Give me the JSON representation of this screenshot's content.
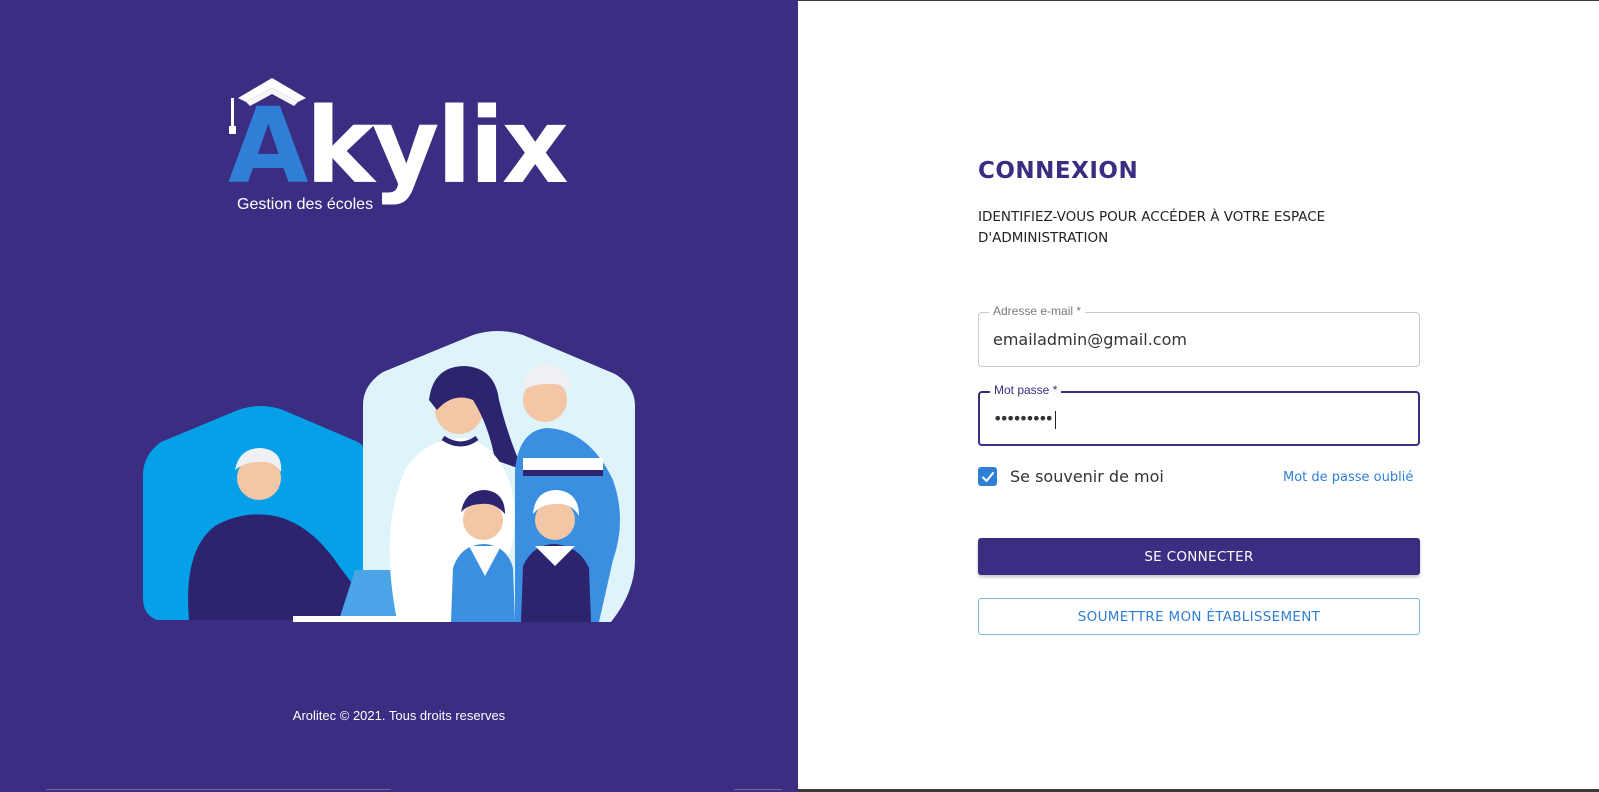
{
  "brand": {
    "name_first_letter": "A",
    "name_rest": "kylix",
    "tagline": "Gestion des écoles",
    "accent_color": "#2f7fd6",
    "panel_color": "#3a2d82"
  },
  "footer": {
    "copyright": "Arolitec © 2021. Tous droits reserves"
  },
  "login": {
    "title": "CONNEXION",
    "subtitle": "IDENTIFIEZ-VOUS POUR ACCÉDER À VOTRE ESPACE D'ADMINISTRATION",
    "email": {
      "label": "Adresse e-mail *",
      "value": "emailadmin@gmail.com"
    },
    "password": {
      "label": "Mot passe *",
      "value": "•••••••••"
    },
    "remember_me": {
      "label": "Se souvenir de moi",
      "checked": true
    },
    "forgot_password": "Mot de passe oublié",
    "submit_label": "SE CONNECTER",
    "secondary_label": "SOUMETTRE MON ÉTABLISSEMENT"
  },
  "icons": {
    "check": "check-icon",
    "graduation_cap": "graduation-cap-icon"
  }
}
